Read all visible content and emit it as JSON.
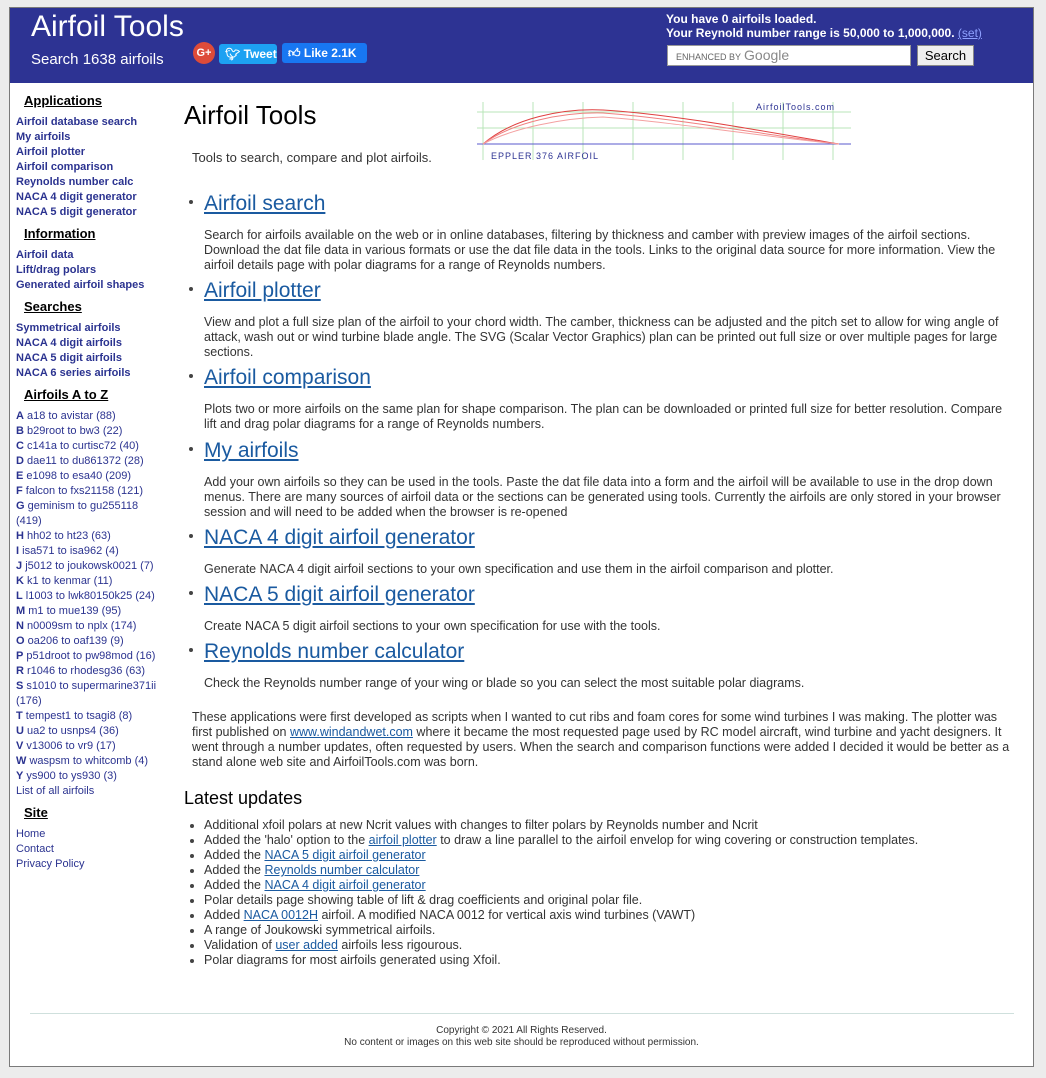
{
  "header": {
    "title": "Airfoil Tools",
    "subtitle": "Search 1638 airfoils",
    "gplus": "G+",
    "tweet": "Tweet",
    "like": "Like 2.1K",
    "loaded": "You have 0 airfoils loaded.",
    "reynolds": "Your Reynold number range is 50,000 to 1,000,000.",
    "set_link": "(set)",
    "search_label": "ENHANCED BY",
    "search_brand": "Google",
    "search_button": "Search",
    "colors": {
      "bar": "#2d3393",
      "link": "#1a5aa0",
      "side_link": "#2b3390"
    }
  },
  "sidebar": {
    "applications_title": "Applications",
    "applications": [
      "Airfoil database search",
      "My airfoils",
      "Airfoil plotter",
      "Airfoil comparison",
      "Reynolds number calc",
      "NACA 4 digit generator",
      "NACA 5 digit generator"
    ],
    "information_title": "Information",
    "information": [
      "Airfoil data",
      "Lift/drag polars",
      "Generated airfoil shapes"
    ],
    "searches_title": "Searches",
    "searches": [
      "Symmetrical airfoils",
      "NACA 4 digit airfoils",
      "NACA 5 digit airfoils",
      "NACA 6 series airfoils"
    ],
    "az_title": "Airfoils A to Z",
    "az": [
      {
        "letter": "A",
        "text": "a18 to avistar (88)"
      },
      {
        "letter": "B",
        "text": "b29root to bw3 (22)"
      },
      {
        "letter": "C",
        "text": "c141a to curtisc72 (40)"
      },
      {
        "letter": "D",
        "text": "dae11 to du861372 (28)"
      },
      {
        "letter": "E",
        "text": "e1098 to esa40 (209)"
      },
      {
        "letter": "F",
        "text": "falcon to fxs21158 (121)"
      },
      {
        "letter": "G",
        "text": "geminism to gu255118"
      },
      {
        "letter": "",
        "text": "(419)"
      },
      {
        "letter": "H",
        "text": "hh02 to ht23 (63)"
      },
      {
        "letter": "I",
        "text": "isa571 to isa962 (4)"
      },
      {
        "letter": "J",
        "text": "j5012 to joukowsk0021 (7)"
      },
      {
        "letter": "K",
        "text": "k1 to kenmar (11)"
      },
      {
        "letter": "L",
        "text": "l1003 to lwk80150k25 (24)"
      },
      {
        "letter": "M",
        "text": "m1 to mue139 (95)"
      },
      {
        "letter": "N",
        "text": "n0009sm to nplx (174)"
      },
      {
        "letter": "O",
        "text": "oa206 to oaf139 (9)"
      },
      {
        "letter": "P",
        "text": "p51droot to pw98mod (16)"
      },
      {
        "letter": "R",
        "text": "r1046 to rhodesg36 (63)"
      },
      {
        "letter": "S",
        "text": "s1010 to supermarine371ii"
      },
      {
        "letter": "",
        "text": "(176)"
      },
      {
        "letter": "T",
        "text": "tempest1 to tsagi8 (8)"
      },
      {
        "letter": "U",
        "text": "ua2 to usnps4 (36)"
      },
      {
        "letter": "V",
        "text": "v13006 to vr9 (17)"
      },
      {
        "letter": "W",
        "text": "waspsm to whitcomb (4)"
      },
      {
        "letter": "Y",
        "text": "ys900 to ys930 (3)"
      },
      {
        "letter": "",
        "text": "List of all airfoils"
      }
    ],
    "site_title": "Site",
    "site": [
      "Home",
      "Contact",
      "Privacy Policy"
    ]
  },
  "main": {
    "title": "Airfoil Tools",
    "intro": "Tools to search, compare and plot airfoils.",
    "banner_brand": "AirfoilTools.com",
    "banner_label": "EPPLER 376  AIRFOIL",
    "sections": [
      {
        "title": "Airfoil search",
        "desc": "Search for airfoils available on the web or in online databases, filtering by thickness and camber with preview images of the airfoil sections. Download the dat file data in various formats or use the dat file data in the tools. Links to the original data source for more information. View the airfoil details page with polar diagrams for a range of Reynolds numbers."
      },
      {
        "title": "Airfoil plotter",
        "desc": "View and plot a full size plan of the airfoil to your chord width. The camber, thickness can be adjusted and the pitch set to allow for wing angle of attack, wash out or wind turbine blade angle. The SVG (Scalar Vector Graphics) plan can be printed out full size or over multiple pages for large sections."
      },
      {
        "title": "Airfoil comparison",
        "desc": "Plots two or more airfoils on the same plan for shape comparison. The plan can be downloaded or printed full size for better resolution. Compare lift and drag polar diagrams for a range of Reynolds numbers."
      },
      {
        "title": "My airfoils",
        "desc": "Add your own airfoils so they can be used in the tools. Paste the dat file data into a form and the airfoil will be available to use in the drop down menus. There are many sources of airfoil data or the sections can be generated using tools. Currently the airfoils are only stored in your browser session and will need to be added when the browser is re-opened"
      },
      {
        "title": "NACA 4 digit airfoil generator",
        "desc": "Generate NACA 4 digit airfoil sections to your own specification and use them in the airfoil comparison and plotter."
      },
      {
        "title": "NACA 5 digit airfoil generator",
        "desc": "Create NACA 5 digit airfoil sections to your own specification for use with the tools."
      },
      {
        "title": "Reynolds number calculator",
        "desc": "Check the Reynolds number range of your wing or blade so you can select the most suitable polar diagrams."
      }
    ],
    "closing_before": "These applications were first developed as scripts when I wanted to cut ribs and foam cores for some wind turbines I was making. The plotter was first published on ",
    "closing_link": "www.windandwet.com",
    "closing_after": " where it became the most requested page used by RC model aircraft, wind turbine and yacht designers. It went through a number updates, often requested by users. When the search and comparison functions were added I decided it would be better as a stand alone web site and AirfoilTools.com was born.",
    "updates_title": "Latest updates",
    "updates": [
      {
        "before": "Additional xfoil polars at new Ncrit values with changes to filter polars by Reynolds number and Ncrit",
        "link": "",
        "after": ""
      },
      {
        "before": "Added the 'halo' option to the ",
        "link": "airfoil plotter",
        "after": " to draw a line parallel to the airfoil envelop for wing covering or construction templates."
      },
      {
        "before": "Added the ",
        "link": "NACA 5 digit airfoil generator",
        "after": ""
      },
      {
        "before": "Added the ",
        "link": "Reynolds number calculator",
        "after": ""
      },
      {
        "before": "Added the ",
        "link": "NACA 4 digit airfoil generator",
        "after": ""
      },
      {
        "before": "Polar details page showing table of lift & drag coefficients and original polar file.",
        "link": "",
        "after": ""
      },
      {
        "before": "Added ",
        "link": "NACA 0012H",
        "after": " airfoil. A modified NACA 0012 for vertical axis wind turbines (VAWT)"
      },
      {
        "before": "A range of Joukowski symmetrical airfoils.",
        "link": "",
        "after": ""
      },
      {
        "before": "Validation of ",
        "link": "user added",
        "after": " airfoils less rigourous."
      },
      {
        "before": "Polar diagrams for most airfoils generated using Xfoil.",
        "link": "",
        "after": ""
      }
    ]
  },
  "footer": {
    "copyright": "Copyright © 2021 All Rights Reserved.",
    "notice": "No content or images on this web site should be reproduced without permission."
  }
}
